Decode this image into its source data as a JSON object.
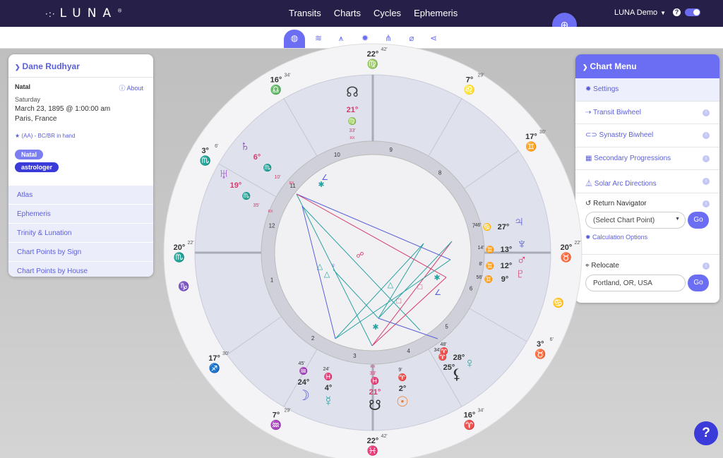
{
  "app": {
    "logo": "LUNA",
    "logo_dots": "·:·",
    "logo_mark": "®"
  },
  "nav": [
    "Transits",
    "Charts",
    "Cycles",
    "Ephemeris"
  ],
  "user": {
    "name": "LUNA Demo",
    "help": "?"
  },
  "fab_icon": "plus-circle",
  "toolbar": [
    "globe",
    "layers",
    "compass",
    "gear",
    "hierarchy",
    "paperclip",
    "share"
  ],
  "profile": {
    "name": "Dane Rudhyar",
    "type": "Natal",
    "about": "About",
    "day": "Saturday",
    "datetime": "March 23, 1895 @ 1:00:00 am",
    "place": "Paris, France",
    "rating": "(AA) - BC/BR in hand",
    "tags": [
      "Natal",
      "astrologer"
    ],
    "links": [
      "Atlas",
      "Ephemeris",
      "Trinity & Lunation",
      "Chart Points by Sign",
      "Chart Points by House"
    ]
  },
  "chart_menu": {
    "title": "Chart Menu",
    "items": [
      "Settings",
      "Transit Biwheel",
      "Synastry Biwheel",
      "Secondary Progressions",
      "Solar Arc Directions"
    ],
    "return_navigator": "Return Navigator",
    "select_placeholder": "(Select Chart Point)",
    "go": "Go",
    "calc_options": "Calculation Options",
    "relocate": "Relocate",
    "relocate_value": "Portland, OR, USA"
  },
  "wheel": {
    "cusps": [
      {
        "deg": "22°",
        "sign": "♍",
        "min": "42'"
      },
      {
        "deg": "7°",
        "sign": "♌",
        "min": "29'"
      },
      {
        "deg": "17°",
        "sign": "♊",
        "min": "30'"
      },
      {
        "deg": "20°",
        "sign": "♉",
        "min": "22'"
      },
      {
        "deg": "3°",
        "sign": "♉",
        "min": "6'"
      },
      {
        "deg": "16°",
        "sign": "♈",
        "min": "34'"
      },
      {
        "deg": "22°",
        "sign": "♓",
        "min": "42'"
      },
      {
        "deg": "7°",
        "sign": "♒",
        "min": "29'"
      },
      {
        "deg": "17°",
        "sign": "♐",
        "min": "30'"
      },
      {
        "deg": "20°",
        "sign": "♏",
        "min": "22'"
      },
      {
        "deg": "3°",
        "sign": "♏",
        "min": "6'"
      },
      {
        "deg": "16°",
        "sign": "♎",
        "min": "34'"
      }
    ],
    "extra_signs": [
      "♋",
      "♑"
    ],
    "houses": [
      "1",
      "2",
      "3",
      "4",
      "5",
      "6",
      "7",
      "8",
      "9",
      "10",
      "11",
      "12"
    ],
    "planets": [
      {
        "g": "☊",
        "deg": "21°",
        "sign": "♍",
        "min": "33'",
        "rx": "RX"
      },
      {
        "g": "♄",
        "deg": "6°",
        "sign": "♏",
        "min": "10'",
        "rx": "RX"
      },
      {
        "g": "♅",
        "deg": "19°",
        "sign": "♏",
        "min": "35'",
        "rx": "RX"
      },
      {
        "g": "♃",
        "deg": "27°",
        "sign": "♋",
        "min": "46'"
      },
      {
        "g": "♆",
        "deg": "13°",
        "sign": "♊",
        "min": "14'"
      },
      {
        "g": "♂",
        "deg": "12°",
        "sign": "♊",
        "min": "8'"
      },
      {
        "g": "♇",
        "deg": "9°",
        "sign": "♊",
        "min": "56'"
      },
      {
        "g": "♀",
        "deg": "28°",
        "sign": "♈",
        "min": "48'"
      },
      {
        "g": "⚸",
        "deg": "25°",
        "sign": "♈",
        "min": "34'"
      },
      {
        "g": "☉",
        "deg": "2°",
        "sign": "♈",
        "min": "9'"
      },
      {
        "g": "☋",
        "deg": "21°",
        "sign": "♓",
        "min": "33'",
        "rx": "RX"
      },
      {
        "g": "☿",
        "deg": "4°",
        "sign": "♓",
        "min": "24'"
      },
      {
        "g": "☽",
        "deg": "24°",
        "sign": "♒",
        "min": "45'"
      }
    ]
  },
  "colors": {
    "primary": "#6b6ef2",
    "navy": "#262048",
    "sign": "#d63a6a",
    "air": "#5b5fd8",
    "water": "#2aa3a3",
    "earth": "#555"
  }
}
